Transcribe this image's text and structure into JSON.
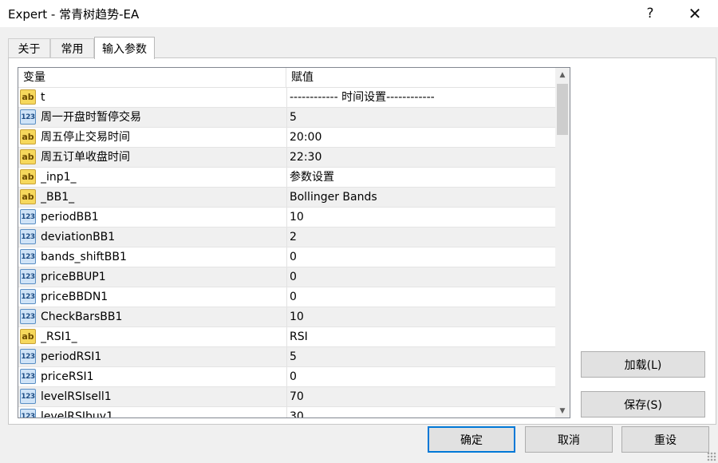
{
  "window": {
    "title": "Expert - 常青树趋势-EA",
    "help_glyph": "?",
    "close_glyph": "✕"
  },
  "tabs": [
    {
      "label": "关于",
      "active": false
    },
    {
      "label": "常用",
      "active": false
    },
    {
      "label": "输入参数",
      "active": true
    }
  ],
  "grid": {
    "col_variable": "变量",
    "col_value": "赋值",
    "rows": [
      {
        "type": "ab",
        "name": "t",
        "value": "------------ 时间设置------------"
      },
      {
        "type": "num",
        "name": "周一开盘时暂停交易",
        "value": "5"
      },
      {
        "type": "ab",
        "name": "周五停止交易时间",
        "value": "20:00"
      },
      {
        "type": "ab",
        "name": "周五订单收盘时间",
        "value": "22:30"
      },
      {
        "type": "ab",
        "name": "_inp1_",
        "value": "参数设置"
      },
      {
        "type": "ab",
        "name": "_BB1_",
        "value": "Bollinger Bands"
      },
      {
        "type": "num",
        "name": "periodBB1",
        "value": "10"
      },
      {
        "type": "num",
        "name": "deviationBB1",
        "value": "2"
      },
      {
        "type": "num",
        "name": "bands_shiftBB1",
        "value": "0"
      },
      {
        "type": "num",
        "name": "priceBBUP1",
        "value": "0"
      },
      {
        "type": "num",
        "name": "priceBBDN1",
        "value": "0"
      },
      {
        "type": "num",
        "name": "CheckBarsBB1",
        "value": "10"
      },
      {
        "type": "ab",
        "name": "_RSI1_",
        "value": "RSI"
      },
      {
        "type": "num",
        "name": "periodRSI1",
        "value": "5"
      },
      {
        "type": "num",
        "name": "priceRSI1",
        "value": "0"
      },
      {
        "type": "num",
        "name": "levelRSIsell1",
        "value": "70"
      },
      {
        "type": "num",
        "name": "levelRSIbuy1",
        "value": "30"
      }
    ]
  },
  "icons": {
    "ab_glyph": "ab",
    "num_glyph": "123",
    "scroll_up_glyph": "▲",
    "scroll_down_glyph": "▼"
  },
  "buttons": {
    "load": "加载(L)",
    "save": "保存(S)",
    "ok": "确定",
    "cancel": "取消",
    "reset": "重设"
  }
}
